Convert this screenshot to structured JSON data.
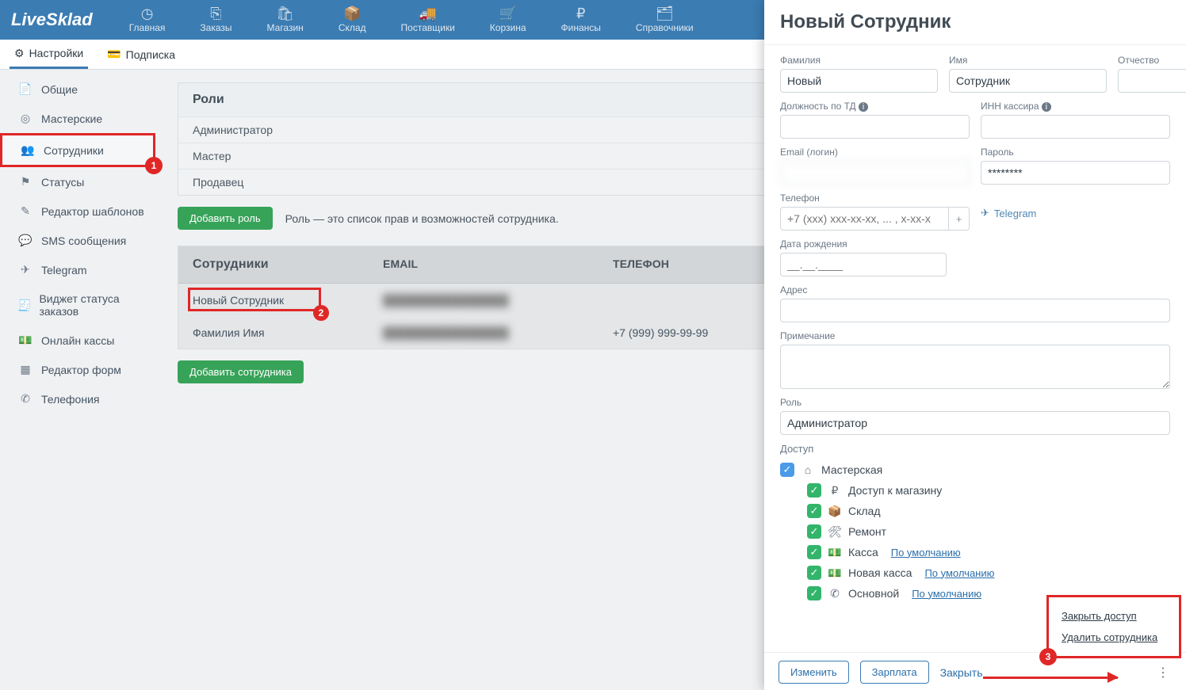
{
  "logo": "LiveSklad",
  "topnav": [
    {
      "icon": "◷",
      "label": "Главная"
    },
    {
      "icon": "⎘",
      "label": "Заказы"
    },
    {
      "icon": "🛍",
      "label": "Магазин"
    },
    {
      "icon": "📦",
      "label": "Склад"
    },
    {
      "icon": "🚚",
      "label": "Поставщики"
    },
    {
      "icon": "🛒",
      "label": "Корзина"
    },
    {
      "icon": "₽",
      "label": "Финансы"
    },
    {
      "icon": "🗂",
      "label": "Справочники"
    }
  ],
  "subnav": {
    "settings": "Настройки",
    "subscription": "Подписка"
  },
  "sidebar": [
    {
      "icon": "📄",
      "label": "Общие"
    },
    {
      "icon": "◎",
      "label": "Мастерские"
    },
    {
      "icon": "👥",
      "label": "Сотрудники"
    },
    {
      "icon": "⚑",
      "label": "Статусы"
    },
    {
      "icon": "✎",
      "label": "Редактор шаблонов"
    },
    {
      "icon": "💬",
      "label": "SMS сообщения"
    },
    {
      "icon": "✈",
      "label": "Telegram"
    },
    {
      "icon": "🧾",
      "label": "Виджет статуса заказов"
    },
    {
      "icon": "💵",
      "label": "Онлайн кассы"
    },
    {
      "icon": "▦",
      "label": "Редактор форм"
    },
    {
      "icon": "✆",
      "label": "Телефония"
    }
  ],
  "annotations": {
    "b1": "1",
    "b2": "2",
    "b3": "3"
  },
  "roles": {
    "title": "Роли",
    "items": [
      "Администратор",
      "Мастер",
      "Продавец"
    ],
    "add_btn": "Добавить роль",
    "hint": "Роль — это список прав и возможностей сотрудника."
  },
  "employees": {
    "title": "Сотрудники",
    "col_email": "EMAIL",
    "col_phone": "ТЕЛЕФОН",
    "rows": [
      {
        "name": "Новый Сотрудник",
        "email": "████████████████",
        "phone": ""
      },
      {
        "name": "Фамилия Имя",
        "email": "████████████████",
        "phone": "+7 (999) 999-99-99"
      }
    ],
    "add_btn": "Добавить сотрудника"
  },
  "drawer": {
    "title": "Новый Сотрудник",
    "labels": {
      "last": "Фамилия",
      "first": "Имя",
      "mid": "Отчество",
      "position": "Должность по ТД",
      "inn": "ИНН кассира",
      "email": "Email (логин)",
      "password": "Пароль",
      "phone": "Телефон",
      "telegram": "Telegram",
      "dob": "Дата рождения",
      "address": "Адрес",
      "note": "Примечание",
      "role": "Роль",
      "access": "Доступ"
    },
    "values": {
      "last": "Новый",
      "first": "Сотрудник",
      "mid": "",
      "position": "",
      "inn": "",
      "email": "",
      "password": "********",
      "phone_placeholder": "+7 (xxx) xxx-xx-xx, ... , x-xx-x",
      "dob_placeholder": "__.__.____",
      "address": "",
      "role": "Администратор"
    },
    "access": {
      "root": "Мастерская",
      "children": [
        {
          "icon": "₽",
          "label": "Доступ к магазину"
        },
        {
          "icon": "📦",
          "label": "Склад"
        },
        {
          "icon": "🛠",
          "label": "Ремонт"
        },
        {
          "icon": "💵",
          "label": "Касса",
          "def": "По умолчанию"
        },
        {
          "icon": "💵",
          "label": "Новая касса",
          "def": "По умолчанию"
        },
        {
          "icon": "✆",
          "label": "Основной",
          "def": "По умолчанию"
        }
      ]
    },
    "footer": {
      "edit": "Изменить",
      "salary": "Зарплата",
      "close": "Закрыть"
    },
    "popup": {
      "close_access": "Закрыть доступ",
      "delete": "Удалить сотрудника"
    }
  }
}
